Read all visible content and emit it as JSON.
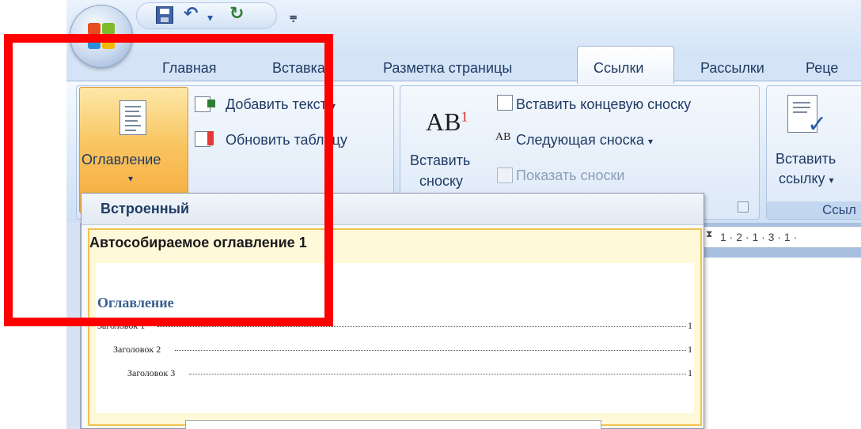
{
  "tabs": {
    "home": "Главная",
    "insert": "Вставка",
    "layout": "Разметка страницы",
    "references": "Ссылки",
    "mailings": "Рассылки",
    "review": "Реце"
  },
  "ribbon": {
    "toc_group": {
      "toc_button": "Оглавление",
      "add_text": "Добавить текст",
      "update_table": "Обновить таблицу"
    },
    "footnotes_group": {
      "insert_footnote_line1": "Вставить",
      "insert_footnote_line2": "сноску",
      "insert_endnote": "Вставить концевую сноску",
      "next_footnote": "Следующая сноска",
      "show_notes": "Показать сноски",
      "ab_icon_text": "AB",
      "ab_superscript": "1"
    },
    "citations_group": {
      "insert_citation_line1": "Вставить",
      "insert_citation_line2": "ссылку",
      "group_label": "Ссыл"
    }
  },
  "gallery": {
    "section_header": "Встроенный",
    "item_title": "Автособираемое оглавление 1",
    "preview": {
      "heading": "Оглавление",
      "entries": [
        {
          "text": "Заголовок 1",
          "page": "1"
        },
        {
          "text": "Заголовок 2",
          "page": "1"
        },
        {
          "text": "Заголовок 3",
          "page": "1"
        }
      ]
    }
  },
  "ruler": {
    "text": "1 · 2 · 1 · 3 · 1 ·"
  },
  "colors": {
    "highlight": "#ff0000",
    "active_button": "#f9c562",
    "ribbon": "#dce9f8"
  }
}
